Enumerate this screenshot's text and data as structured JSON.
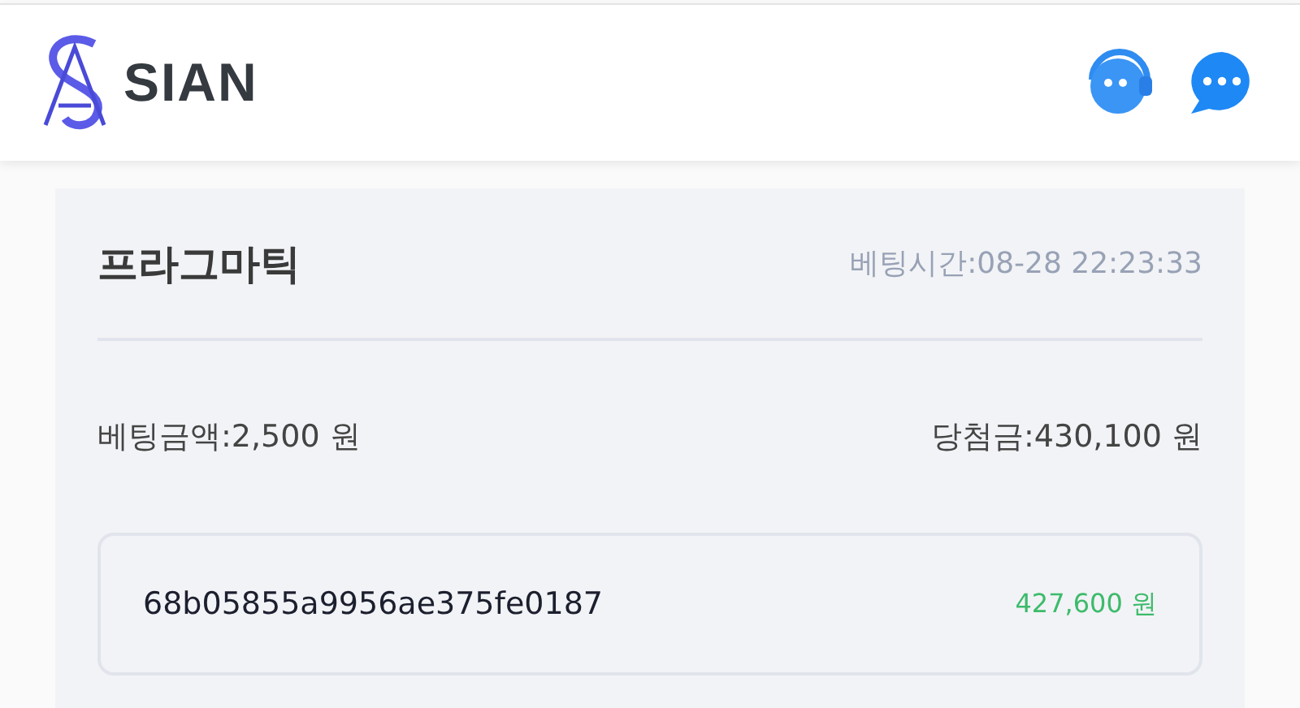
{
  "header": {
    "brand": "SIAN"
  },
  "bet": {
    "game": "프라그마틱",
    "bet_time": "베팅시간:08-28 22:23:33",
    "bet_amount": "베팅금액:2,500 원",
    "win_amount": "당첨금:430,100 원",
    "entries": [
      {
        "id": "68b05855a9956ae375fe0187",
        "amount": "427,600 원"
      }
    ]
  }
}
